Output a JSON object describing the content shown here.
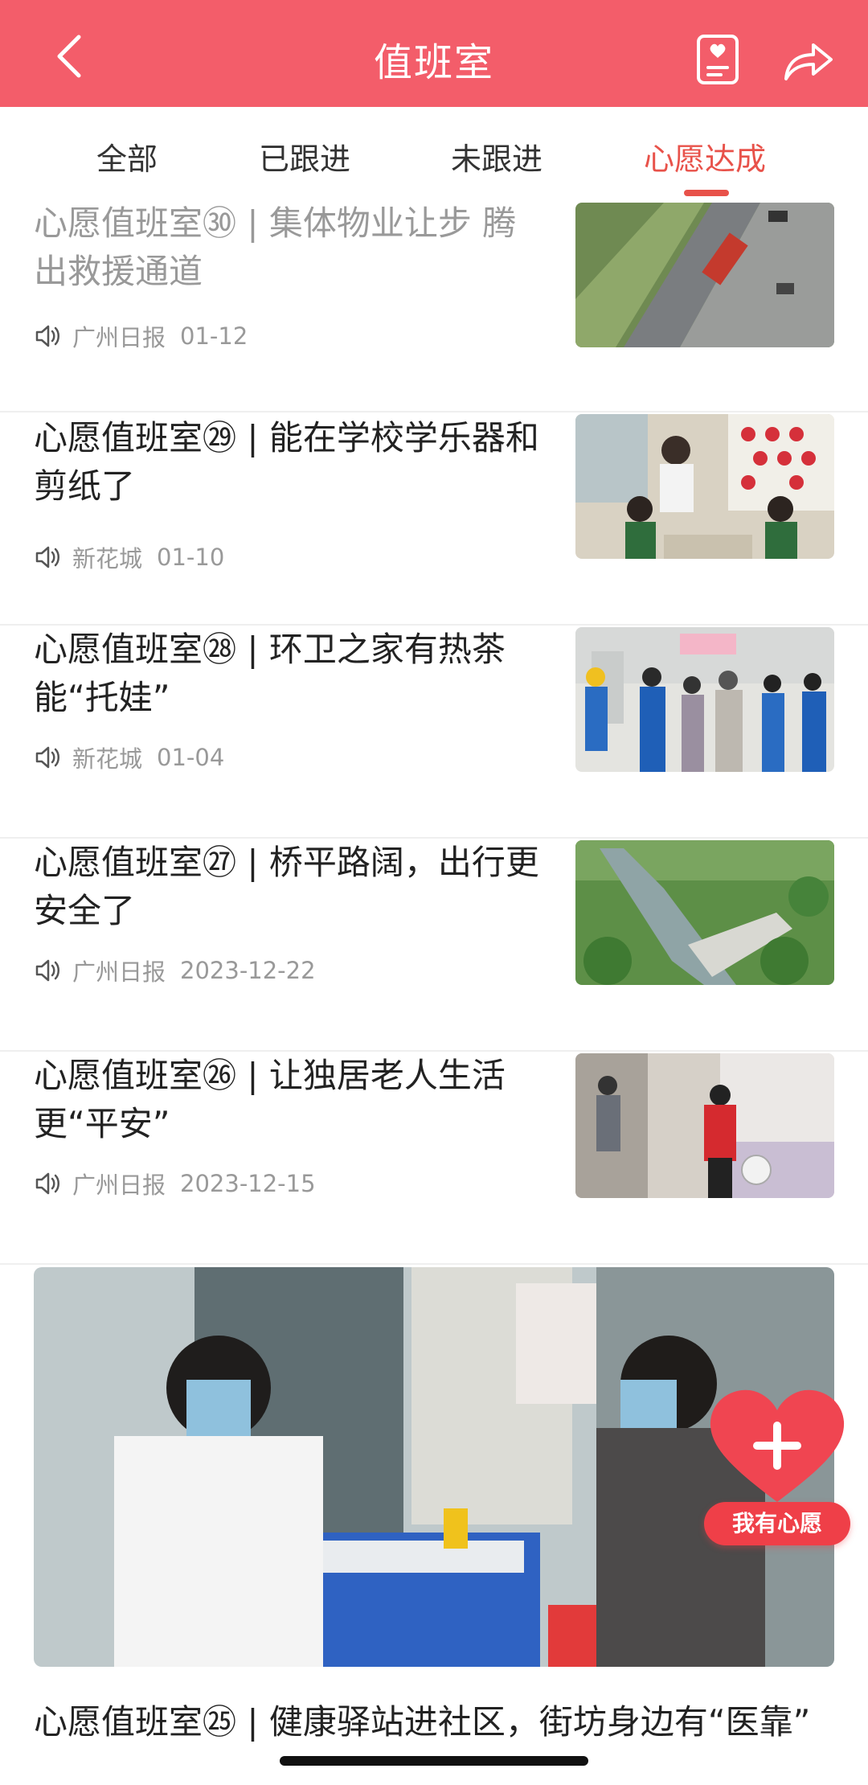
{
  "header": {
    "title": "值班室"
  },
  "tabs": [
    {
      "label": "全部"
    },
    {
      "label": "已跟进"
    },
    {
      "label": "未跟进"
    },
    {
      "label": "心愿达成"
    }
  ],
  "articles": [
    {
      "title": "心愿值班室㉚ | 集体物业让步 腾出救援通道",
      "source": "广州日报",
      "date": "01-12",
      "faded": true
    },
    {
      "title": "心愿值班室㉙ | 能在学校学乐器和剪纸了",
      "source": "新花城",
      "date": "01-10"
    },
    {
      "title": "心愿值班室㉘ | 环卫之家有热茶能“托娃”",
      "source": "新花城",
      "date": "01-04"
    },
    {
      "title": "心愿值班室㉗ | 桥平路阔，出行更安全了",
      "source": "广州日报",
      "date": "2023-12-22"
    },
    {
      "title": "心愿值班室㉖ | 让独居老人生活更“平安”",
      "source": "广州日报",
      "date": "2023-12-15"
    }
  ],
  "featured": {
    "title": "心愿值班室㉕ | 健康驿站进社区，街坊身边有“医靠”"
  },
  "wish_button": {
    "label": "我有心愿"
  },
  "colors": {
    "brand": "#f35d6a",
    "accent": "#e8524a",
    "wish": "#ef3f48"
  },
  "icons": [
    "back-arrow-icon",
    "favorite-card-icon",
    "share-icon",
    "speaker-icon",
    "plus-heart-icon"
  ]
}
